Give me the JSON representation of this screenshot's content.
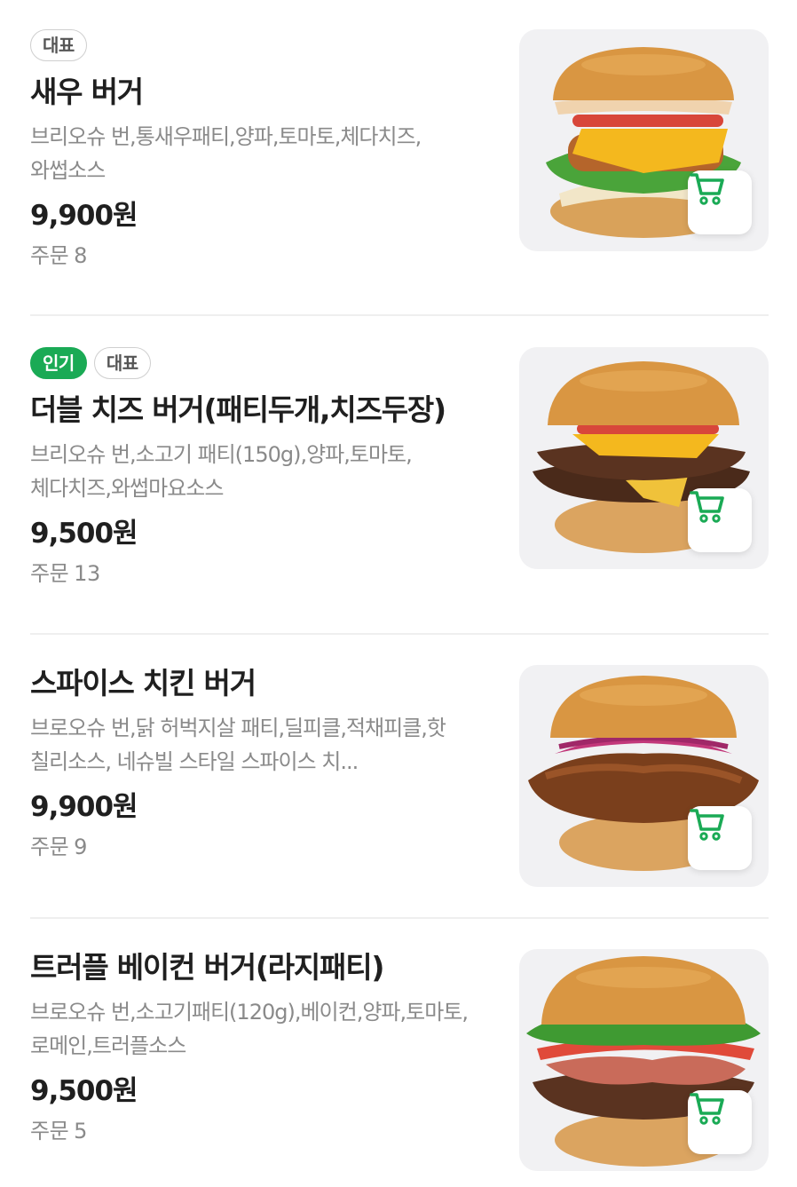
{
  "colors": {
    "accent_green": "#1aaa55",
    "text_primary": "#1f1f1f",
    "text_secondary": "#8a8a8a",
    "thumb_bg": "#f1f1f3"
  },
  "orders_label": "주문",
  "menu": [
    {
      "badges": [
        {
          "label": "대표",
          "style": "outline"
        }
      ],
      "title": "새우 버거",
      "desc": "브리오슈 번,통새우패티,양파,토마토,체다치즈,와썹소스",
      "price": "9,900원",
      "orders": "8",
      "image_icon": "shrimp-burger-image"
    },
    {
      "badges": [
        {
          "label": "인기",
          "style": "green"
        },
        {
          "label": "대표",
          "style": "outline"
        }
      ],
      "title": "더블 치즈 버거(패티두개,치즈두장)",
      "desc": "브리오슈 번,소고기 패티(150g),양파,토마토,체다치즈,와썹마요소스",
      "price": "9,500원",
      "orders": "13",
      "image_icon": "double-cheese-burger-image"
    },
    {
      "badges": [],
      "title": "스파이스 치킨 버거",
      "desc": "브로오슈 번,닭 허벅지살 패티,딜피클,적채피클,핫 칠리소스, 네슈빌 스타일 스파이스 치...",
      "price": "9,900원",
      "orders": "9",
      "image_icon": "spicy-chicken-burger-image"
    },
    {
      "badges": [],
      "title": "트러플 베이컨 버거(라지패티)",
      "desc": "브로오슈 번,소고기패티(120g),베이컨,양파,토마토,로메인,트러플소스",
      "price": "9,500원",
      "orders": "5",
      "image_icon": "truffle-bacon-burger-image"
    }
  ]
}
